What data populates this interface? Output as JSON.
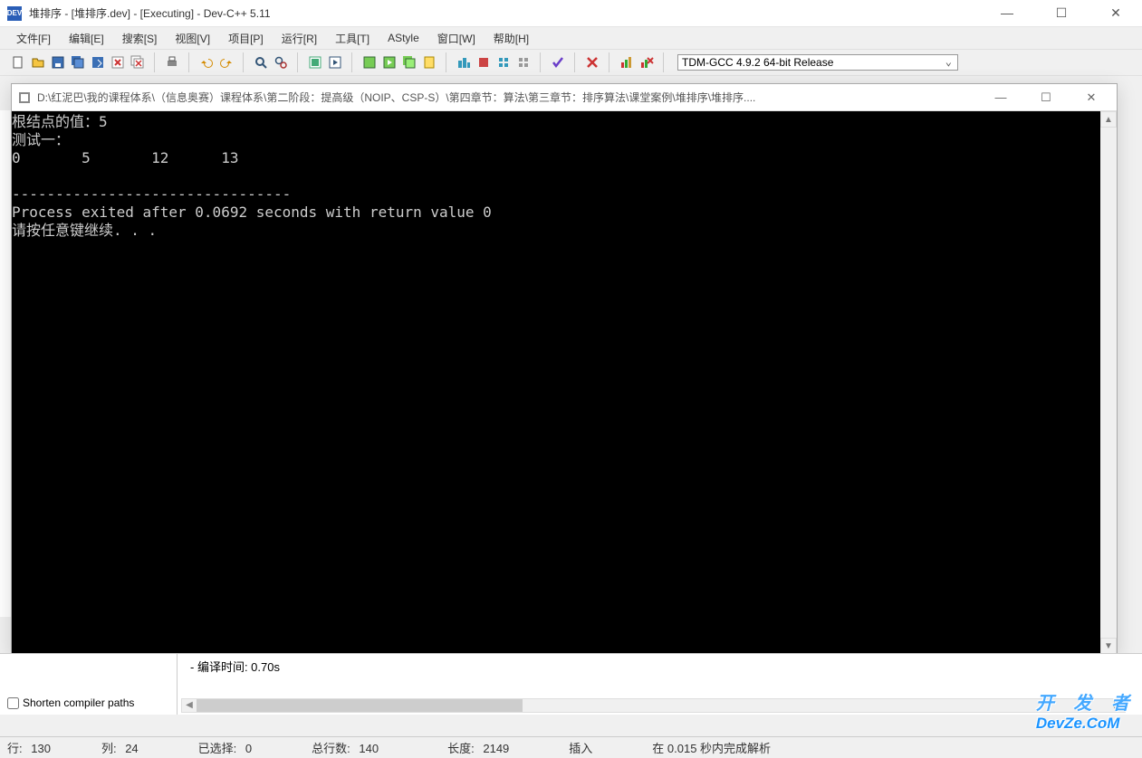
{
  "main_window": {
    "title": "堆排序 - [堆排序.dev] - [Executing] - Dev-C++ 5.11"
  },
  "menubar": {
    "items": [
      "文件[F]",
      "编辑[E]",
      "搜索[S]",
      "视图[V]",
      "项目[P]",
      "运行[R]",
      "工具[T]",
      "AStyle",
      "窗口[W]",
      "帮助[H]"
    ]
  },
  "toolbar": {
    "compiler_selected": "TDM-GCC 4.9.2 64-bit Release"
  },
  "console_window": {
    "title": "D:\\红泥巴\\我的课程体系\\（信息奥赛）课程体系\\第二阶段：提高级（NOIP、CSP-S）\\第四章节：算法\\第三章节：排序算法\\课堂案例\\堆排序\\堆排序....",
    "lines": [
      "根结点的值：5",
      "测试一：",
      "0       5       12      13",
      "",
      "--------------------------------",
      "Process exited after 0.0692 seconds with return value 0",
      "请按任意键继续. . ."
    ]
  },
  "bottom": {
    "shorten_label": "Shorten compiler paths",
    "compile_time_line": "- 编译时间: 0.70s"
  },
  "statusbar": {
    "row_label": "行:",
    "row_val": "130",
    "col_label": "列:",
    "col_val": "24",
    "sel_label": "已选择:",
    "sel_val": "0",
    "total_label": "总行数:",
    "total_val": "140",
    "len_label": "长度:",
    "len_val": "2149",
    "mode": "插入",
    "parse_msg": "在 0.015 秒内完成解析"
  },
  "watermark": {
    "cn": "开 发 者",
    "en": "DevZe.CoM"
  }
}
